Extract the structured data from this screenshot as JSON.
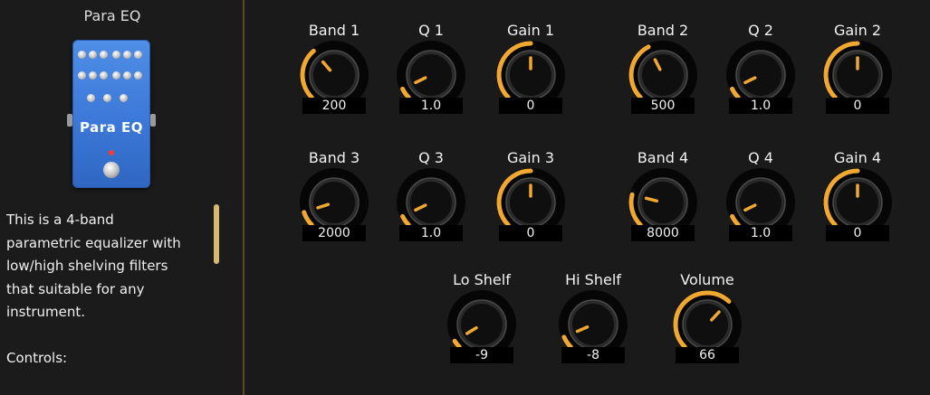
{
  "sidebar": {
    "title": "Para EQ",
    "pedal_name": "Para EQ",
    "description": [
      "This is a 4-band",
      "parametric equalizer with",
      "low/high shelving filters",
      "that suitable for any",
      "instrument."
    ],
    "controls_heading": "Controls:"
  },
  "colors": {
    "accent": "#f0a830",
    "pedal": "#3f7fdc",
    "background": "#1a1a1a"
  },
  "knobs": {
    "band1": {
      "label": "Band 1",
      "value": "200",
      "level": 0.35
    },
    "q1": {
      "label": "Q 1",
      "value": "1.0",
      "level": 0.07
    },
    "gain1": {
      "label": "Gain 1",
      "value": "0",
      "level": 0.5
    },
    "band2": {
      "label": "Band 2",
      "value": "500",
      "level": 0.4
    },
    "q2": {
      "label": "Q 2",
      "value": "1.0",
      "level": 0.07
    },
    "gain2": {
      "label": "Gain 2",
      "value": "0",
      "level": 0.5
    },
    "band3": {
      "label": "Band 3",
      "value": "2000",
      "level": 0.1
    },
    "q3": {
      "label": "Q 3",
      "value": "1.0",
      "level": 0.07
    },
    "gain3": {
      "label": "Gain 3",
      "value": "0",
      "level": 0.5
    },
    "band4": {
      "label": "Band 4",
      "value": "8000",
      "level": 0.22
    },
    "q4": {
      "label": "Q 4",
      "value": "1.0",
      "level": 0.07
    },
    "gain4": {
      "label": "Gain 4",
      "value": "0",
      "level": 0.5
    },
    "lo_shelf": {
      "label": "Lo Shelf",
      "value": "-9",
      "level": 0.05
    },
    "hi_shelf": {
      "label": "Hi Shelf",
      "value": "-8",
      "level": 0.08
    },
    "volume": {
      "label": "Volume",
      "value": "66",
      "level": 0.66
    }
  }
}
